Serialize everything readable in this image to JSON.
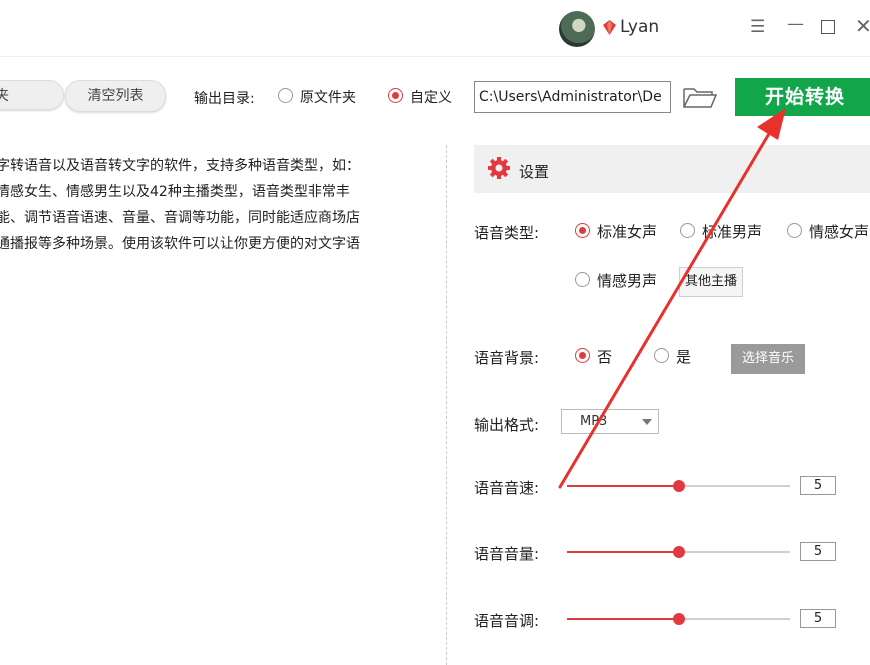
{
  "titlebar": {
    "username": "Lyan"
  },
  "toolbar": {
    "add_folder_label": "件夹",
    "clear_list_label": "清空列表",
    "output_dir_label": "输出目录:",
    "output_options": [
      {
        "label": "原文件夹",
        "checked": false
      },
      {
        "label": "自定义",
        "checked": true
      }
    ],
    "output_path": "C:\\Users\\Administrator\\De",
    "start_label": "开始转换"
  },
  "text_content": {
    "lines": [
      "字转语音以及语音转文字的软件，支持多种语音类型，如：",
      "情感女生、情感男生以及42种主播类型，语音类型非常丰",
      "能、调节语音语速、音量、音调等功能，同时能适应商场店",
      "通播报等多种场景。使用该软件可以让你更方便的对文字语"
    ]
  },
  "settings": {
    "title": "设置",
    "voice_type": {
      "label": "语音类型:",
      "options": [
        {
          "label": "标准女声",
          "checked": true
        },
        {
          "label": "标准男声",
          "checked": false
        },
        {
          "label": "情感女声",
          "checked": false
        },
        {
          "label": "情感男声",
          "checked": false
        }
      ],
      "other_anchor_label": "其他主播"
    },
    "background": {
      "label": "语音背景:",
      "options": [
        {
          "label": "否",
          "checked": true
        },
        {
          "label": "是",
          "checked": false
        }
      ],
      "choose_music_label": "选择音乐"
    },
    "format": {
      "label": "输出格式:",
      "value": "MP3"
    },
    "speed": {
      "label": "语音音速:",
      "value": "5",
      "fraction": 0.5
    },
    "volume": {
      "label": "语音音量:",
      "value": "5",
      "fraction": 0.5
    },
    "pitch": {
      "label": "语音音调:",
      "value": "5",
      "fraction": 0.5
    }
  },
  "colors": {
    "accent_red": "#e2383f",
    "start_green": "#12a64a",
    "annotation_arrow": "#e8312c"
  }
}
